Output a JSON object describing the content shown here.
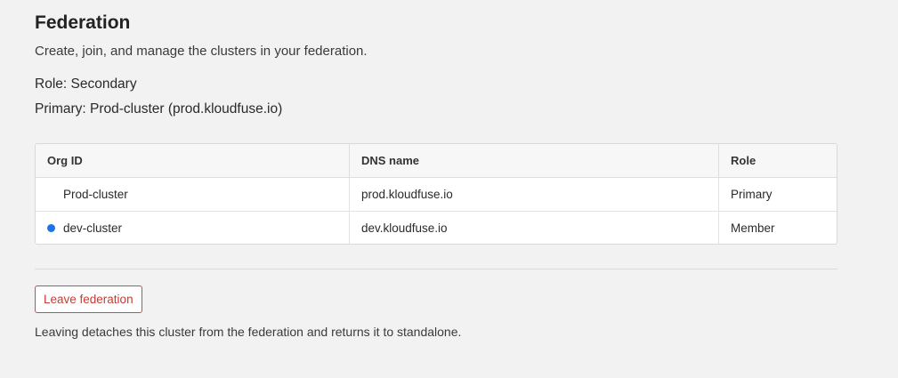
{
  "header": {
    "title": "Federation",
    "subtitle": "Create, join, and manage the clusters in your federation."
  },
  "status": {
    "role": "Role: Secondary",
    "primary": "Primary: Prod-cluster (prod.kloudfuse.io)"
  },
  "table": {
    "columns": [
      "Org ID",
      "DNS name",
      "Role"
    ],
    "rows": [
      {
        "org_id": "Prod-cluster",
        "dns_name": "prod.kloudfuse.io",
        "role": "Primary",
        "current": false
      },
      {
        "org_id": "dev-cluster",
        "dns_name": "dev.kloudfuse.io",
        "role": "Member",
        "current": true
      }
    ]
  },
  "actions": {
    "leave_label": "Leave federation",
    "leave_note": "Leaving detaches this cluster from the federation and returns it to standalone."
  },
  "colors": {
    "current_indicator": "#1a73e8",
    "danger": "#c93a30"
  }
}
